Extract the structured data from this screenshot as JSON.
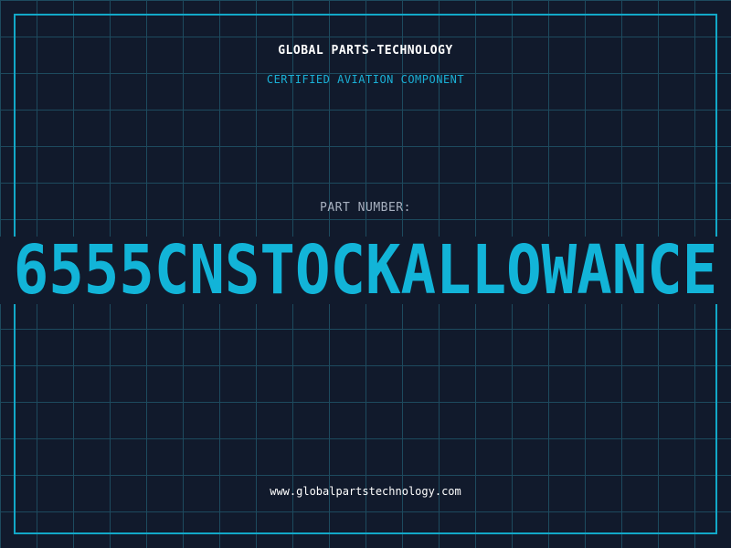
{
  "header": {
    "company": "GLOBAL PARTS-TECHNOLOGY",
    "subtitle": "CERTIFIED AVIATION COMPONENT"
  },
  "part": {
    "label": "PART NUMBER:",
    "number": "6555CNSTOCKALLOWANCE"
  },
  "footer": {
    "url": "www.globalpartstechnology.com"
  },
  "colors": {
    "background": "#111a2c",
    "grid": "#1d4a5e",
    "accent": "#12b4d8",
    "frame": "#12a8c8"
  }
}
